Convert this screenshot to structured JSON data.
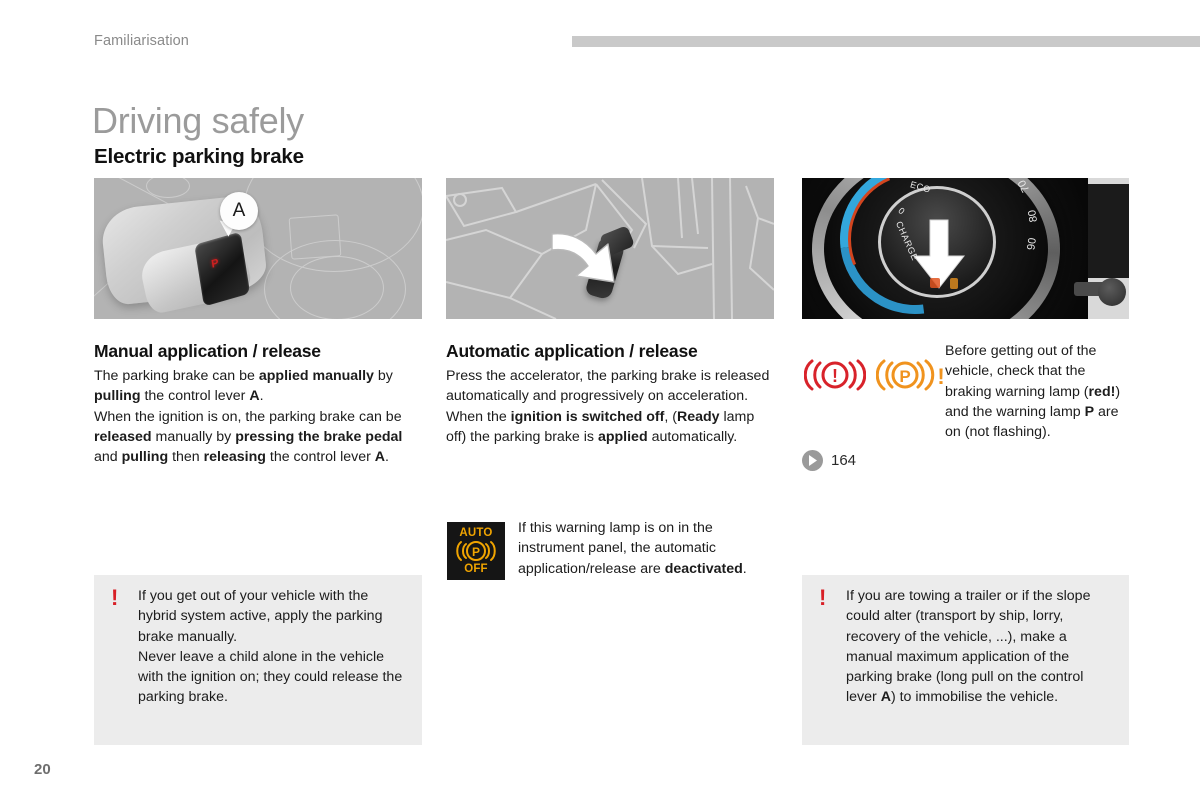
{
  "header": {
    "section_label": "Familiarisation",
    "bar_color": "#c9c9c9"
  },
  "title": {
    "main": "Driving safely",
    "sub": "Electric parking brake",
    "main_color": "#9b9b9b"
  },
  "columns": [
    {
      "id": "manual",
      "heading": "Manual application / release",
      "figure": {
        "name": "parking-brake-lever-illustration",
        "callout_label": "A",
        "switch_symbol": "P"
      },
      "paragraphs": [
        [
          {
            "t": "The parking brake can be "
          },
          {
            "t": "applied manually",
            "b": true
          },
          {
            "t": " by "
          },
          {
            "t": "pulling",
            "b": true
          },
          {
            "t": " the control lever "
          },
          {
            "t": "A",
            "b": true
          },
          {
            "t": "."
          }
        ],
        [
          {
            "t": "When the ignition is on, the parking brake can be "
          },
          {
            "t": "released",
            "b": true
          },
          {
            "t": " manually by "
          },
          {
            "t": "pressing the brake pedal",
            "b": true
          },
          {
            "t": " and "
          },
          {
            "t": "pulling",
            "b": true
          },
          {
            "t": " then "
          },
          {
            "t": "releasing",
            "b": true
          },
          {
            "t": " the control lever "
          },
          {
            "t": "A",
            "b": true
          },
          {
            "t": "."
          }
        ]
      ]
    },
    {
      "id": "automatic",
      "heading": "Automatic application / release",
      "figure": {
        "name": "accelerator-pedal-illustration",
        "arrow": "white-down-right-arrow"
      },
      "paragraphs": [
        [
          {
            "t": "Press the accelerator, the parking brake is released automatically and progressively on acceleration."
          }
        ],
        [
          {
            "t": "When the "
          },
          {
            "t": "ignition is switched off",
            "b": true
          },
          {
            "t": ", ("
          },
          {
            "t": "Ready",
            "b": true
          },
          {
            "t": " lamp off) the parking brake is "
          },
          {
            "t": "applied",
            "b": true
          },
          {
            "t": " automatically."
          }
        ]
      ],
      "lamp_note": {
        "icon": {
          "name": "auto-p-off-warning-lamp-icon",
          "top_word": "AUTO",
          "center_symbol": "((P))",
          "bottom_word": "OFF",
          "background": "#151515",
          "foreground": "#f0a400"
        },
        "text": [
          {
            "t": "If this warning lamp is on in the instrument panel, the automatic application/release are "
          },
          {
            "t": "deactivated",
            "b": true
          },
          {
            "t": "."
          }
        ]
      }
    },
    {
      "id": "instrument-cluster",
      "figure": {
        "name": "instrument-cluster-illustration",
        "gauge_labels": [
          "CHARGE",
          "0",
          "ECO",
          "70",
          "80",
          "90"
        ],
        "arrow": "white-down-arrow"
      },
      "lamps": [
        {
          "name": "brake-warning-lamp-icon",
          "symbol": "((!))",
          "color": "#d8222a"
        },
        {
          "name": "parking-brake-warning-lamp-icon",
          "symbol": "((P))!",
          "color": "#f0931e"
        }
      ],
      "lamp_text": [
        {
          "t": "Before getting out of the vehicle, check that the braking warning lamp ("
        },
        {
          "t": "red!",
          "b": true
        },
        {
          "t": ") and the warning lamp "
        },
        {
          "t": "P",
          "b": true
        },
        {
          "t": " are on (not flashing)."
        }
      ],
      "cross_reference": {
        "icon": "page-reference-arrow-icon",
        "page": "164"
      }
    }
  ],
  "notes": [
    {
      "id": "note-hybrid",
      "symbol": "!",
      "symbol_color": "#d81f26",
      "background": "#ececec",
      "text": [
        {
          "t": "If you get out of your vehicle with the hybrid system active, apply the parking brake manually."
        },
        {
          "t": "\nNever leave a child alone in the vehicle with the ignition on; they could release the parking brake."
        }
      ]
    },
    {
      "id": "note-trailer",
      "symbol": "!",
      "symbol_color": "#d81f26",
      "background": "#ececec",
      "text": [
        {
          "t": "If you are towing a trailer or if the slope could alter (transport by ship, lorry, recovery of the vehicle, ...), make a manual maximum application of the parking brake (long pull on the control lever "
        },
        {
          "t": "A",
          "b": true
        },
        {
          "t": ") to immobilise the vehicle."
        }
      ]
    }
  ],
  "footer": {
    "page_number": "20"
  }
}
